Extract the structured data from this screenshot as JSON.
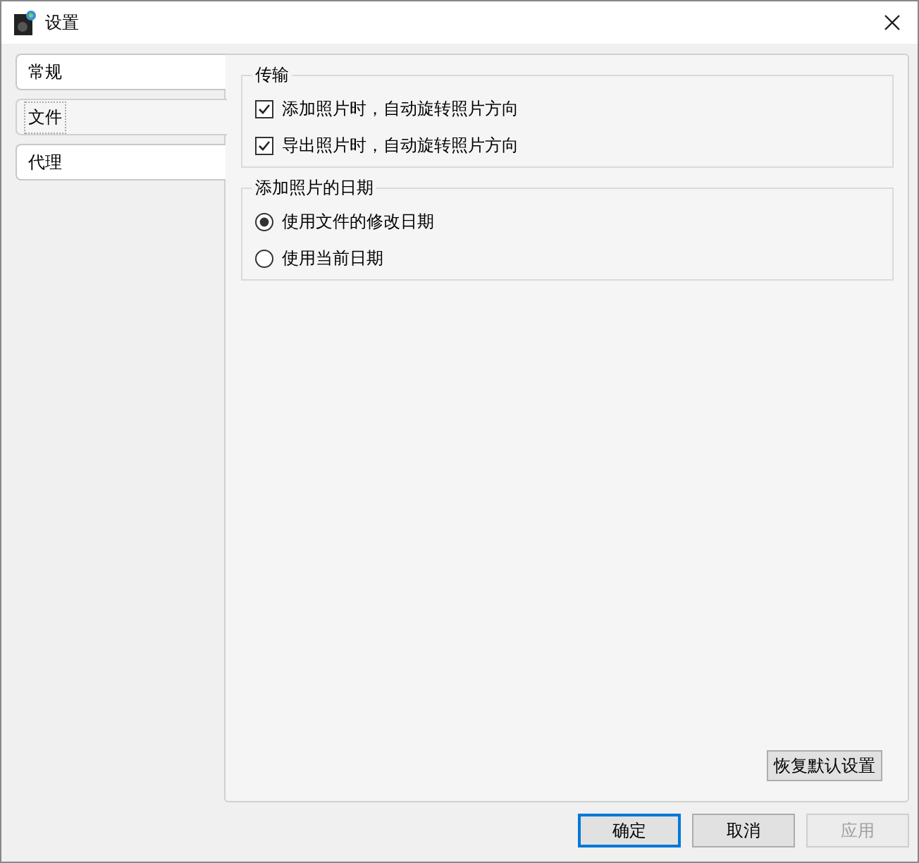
{
  "window": {
    "title": "设置"
  },
  "tabs": [
    {
      "label": "常规",
      "selected": false
    },
    {
      "label": "文件",
      "selected": true
    },
    {
      "label": "代理",
      "selected": false
    }
  ],
  "groups": [
    {
      "title": "传输",
      "options": [
        {
          "kind": "checkbox",
          "label": "添加照片时，自动旋转照片方向",
          "checked": true
        },
        {
          "kind": "checkbox",
          "label": "导出照片时，自动旋转照片方向",
          "checked": true
        }
      ]
    },
    {
      "title": "添加照片的日期",
      "options": [
        {
          "kind": "radio",
          "label": "使用文件的修改日期",
          "selected": true
        },
        {
          "kind": "radio",
          "label": "使用当前日期",
          "selected": false
        }
      ]
    }
  ],
  "restore_button": "恢复默认设置",
  "buttons": [
    {
      "label": "确定",
      "default": true,
      "disabled": false
    },
    {
      "label": "取消",
      "default": false,
      "disabled": false
    },
    {
      "label": "应用",
      "default": false,
      "disabled": true
    }
  ]
}
